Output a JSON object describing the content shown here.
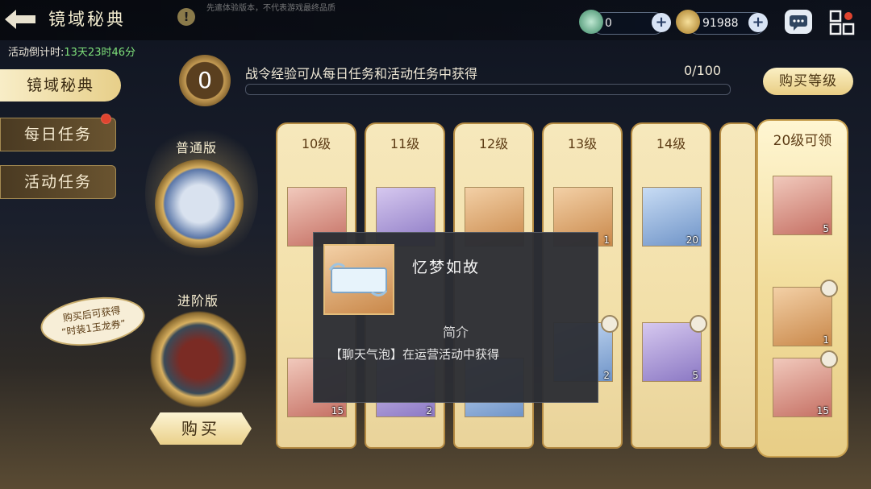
{
  "header": {
    "title": "镜域秘典",
    "disclaimer": "先遣体验版本，不代表游戏最终品质",
    "currency1_value": "0",
    "currency2_value": "91988"
  },
  "countdown": {
    "label": "活动倒计时:",
    "time": "13天23时46分"
  },
  "sidebar": {
    "items": [
      {
        "label": "镜域秘典",
        "active": true
      },
      {
        "label": "每日任务",
        "has_dot": true
      },
      {
        "label": "活动任务"
      }
    ]
  },
  "progress": {
    "level": "0",
    "hint": "战令经验可从每日任务和活动任务中获得",
    "count": "0/100",
    "fraction": 0.0
  },
  "buy_level_label": "购买等级",
  "editions": {
    "normal_label": "普通版",
    "advanced_label": "进阶版",
    "bubble_line1": "购买后可获得",
    "bubble_line2": "“时装1玉龙券”",
    "buy_label": "购买"
  },
  "levels": [
    {
      "label": "10级",
      "top": {
        "bg": "red",
        "count": ""
      },
      "bottom": {
        "bg": "red",
        "count": "15"
      }
    },
    {
      "label": "11级",
      "top": {
        "bg": "purple",
        "count": ""
      },
      "bottom": {
        "bg": "purple",
        "count": "2"
      }
    },
    {
      "label": "12级",
      "top": {
        "bg": "orange",
        "count": ""
      },
      "bottom": {
        "bg": "blue",
        "count": ""
      }
    },
    {
      "label": "13级",
      "top": {
        "bg": "orange",
        "count": "1"
      },
      "bottom": {
        "bg": "blue",
        "count": "2"
      }
    },
    {
      "label": "14级",
      "top": {
        "bg": "blue",
        "count": "20"
      },
      "bottom": {
        "bg": "purple",
        "count": "5"
      }
    }
  ],
  "reward20": {
    "label": "20级可领",
    "items": [
      {
        "bg": "red",
        "count": "5"
      },
      {
        "bg": "orange",
        "count": "1"
      },
      {
        "bg": "red",
        "count": "15"
      }
    ]
  },
  "tooltip": {
    "title": "忆梦如故",
    "section": "简介",
    "description": "【聊天气泡】在运营活动中获得"
  },
  "colors": {
    "accent_gold": "#e9cd84",
    "dark_bg": "#1a1f2c",
    "countdown_green": "#7ee07a"
  }
}
